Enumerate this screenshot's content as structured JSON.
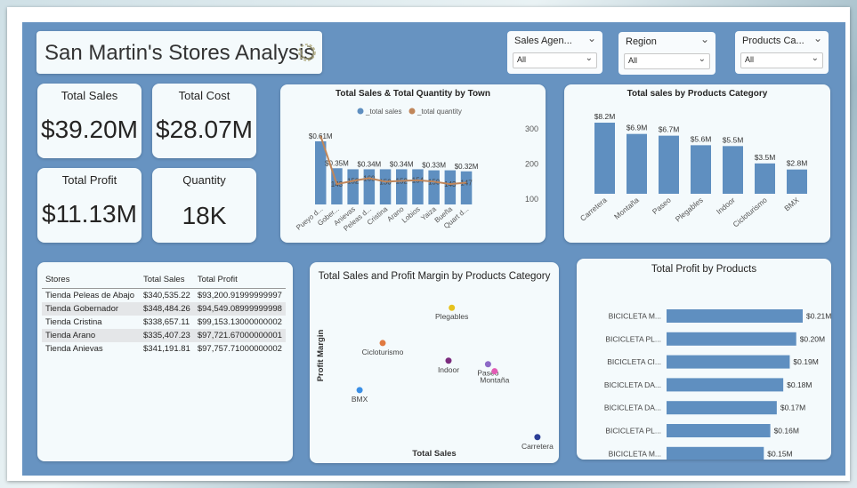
{
  "header": {
    "title": "San Martin's Stores Analysis"
  },
  "slicers": [
    {
      "label": "Sales Agen...",
      "value": "All"
    },
    {
      "label": "Region",
      "value": "All"
    },
    {
      "label": "Products Ca...",
      "value": "All"
    }
  ],
  "kpis": {
    "total_sales": {
      "label": "Total Sales",
      "value": "$39.20M"
    },
    "total_cost": {
      "label": "Total Cost",
      "value": "$28.07M"
    },
    "total_profit": {
      "label": "Total Profit",
      "value": "$11.13M"
    },
    "quantity": {
      "label": "Quantity",
      "value": "18K"
    }
  },
  "colors": {
    "bar": "#5f8fc0",
    "line": "#c0865a",
    "canvas": "#6793c1"
  },
  "table": {
    "columns": [
      "Stores",
      "Total Sales",
      "Total Profit"
    ],
    "rows": [
      [
        "Tienda Peleas de Abajo",
        "$340,535.22",
        "$93,200.91999999997"
      ],
      [
        "Tienda Gobernador",
        "$348,484.26",
        "$94,549.08999999998"
      ],
      [
        "Tienda Cristina",
        "$338,657.11",
        "$99,153.13000000002"
      ],
      [
        "Tienda Arano",
        "$335,407.23",
        "$97,721.67000000001"
      ],
      [
        "Tienda Anievas",
        "$341,191.81",
        "$97,757.71000000002"
      ]
    ]
  },
  "chart_data": [
    {
      "type": "bar",
      "title": "Total Sales & Total Quantity by Town",
      "legend": [
        "_total sales",
        "_total quantity"
      ],
      "legend_position": "top",
      "categories": [
        "Pueyo d...",
        "Gober...",
        "Anievas",
        "Peleas d...",
        "Cristina",
        "Arano",
        "Lobios",
        "Yaiza",
        "Bueña",
        "Quart d..."
      ],
      "series": [
        {
          "name": "_total sales",
          "values": [
            0.61,
            0.35,
            0.34,
            0.34,
            0.34,
            0.34,
            0.34,
            0.33,
            0.33,
            0.32
          ]
        },
        {
          "name": "_total quantity",
          "values": [
            280,
            143,
            152,
            160,
            150,
            152,
            154,
            150,
            143,
            147
          ]
        }
      ],
      "bar_labels": [
        "$0.61M",
        "$0.35M",
        "",
        "$0.34M",
        "",
        "$0.34M",
        "",
        "$0.33M",
        "",
        "$0.32M"
      ],
      "line_labels": [
        "",
        "143",
        "152",
        "160",
        "150",
        "152",
        "154",
        "150",
        "143",
        "147"
      ],
      "y2_ticks": [
        "300",
        "200",
        "100"
      ],
      "y2lim": [
        85,
        333
      ]
    },
    {
      "type": "bar",
      "title": "Total sales by Products Category",
      "categories": [
        "Carretera",
        "Montaña",
        "Paseo",
        "Plegables",
        "Indoor",
        "Cicloturismo",
        "BMX"
      ],
      "values": [
        8.2,
        6.9,
        6.7,
        5.6,
        5.5,
        3.5,
        2.8
      ],
      "labels": [
        "$8.2M",
        "$6.9M",
        "$6.7M",
        "$5.6M",
        "$5.5M",
        "$3.5M",
        "$2.8M"
      ]
    },
    {
      "type": "scatter",
      "title": "Total Sales and Profit Margin by Products Category",
      "xlabel": "Total Sales",
      "ylabel": "Profit Margin",
      "points": [
        {
          "label": "Plegables",
          "x": 5.6,
          "y": 0.34,
          "color": "#e6c21e"
        },
        {
          "label": "Cicloturismo",
          "x": 3.5,
          "y": 0.31,
          "color": "#e07a41"
        },
        {
          "label": "Indoor",
          "x": 5.5,
          "y": 0.295,
          "color": "#7b2c7e"
        },
        {
          "label": "Paseo",
          "x": 6.7,
          "y": 0.292,
          "color": "#8d6ac7"
        },
        {
          "label": "Montaña",
          "x": 6.9,
          "y": 0.286,
          "color": "#e25bb4"
        },
        {
          "label": "BMX",
          "x": 2.8,
          "y": 0.27,
          "color": "#3a8fe6"
        },
        {
          "label": "Carretera",
          "x": 8.2,
          "y": 0.23,
          "color": "#2b3e96"
        }
      ]
    },
    {
      "type": "bar",
      "orientation": "horizontal",
      "title": "Total Profit by Products",
      "categories": [
        "BICICLETA M...",
        "BICICLETA PL...",
        "BICICLETA CI...",
        "BICICLETA DA...",
        "BICICLETA DA...",
        "BICICLETA PL...",
        "BICICLETA M..."
      ],
      "values": [
        0.21,
        0.2,
        0.19,
        0.18,
        0.17,
        0.16,
        0.15
      ],
      "labels": [
        "$0.21M",
        "$0.20M",
        "$0.19M",
        "$0.18M",
        "$0.17M",
        "$0.16M",
        "$0.15M"
      ]
    }
  ]
}
